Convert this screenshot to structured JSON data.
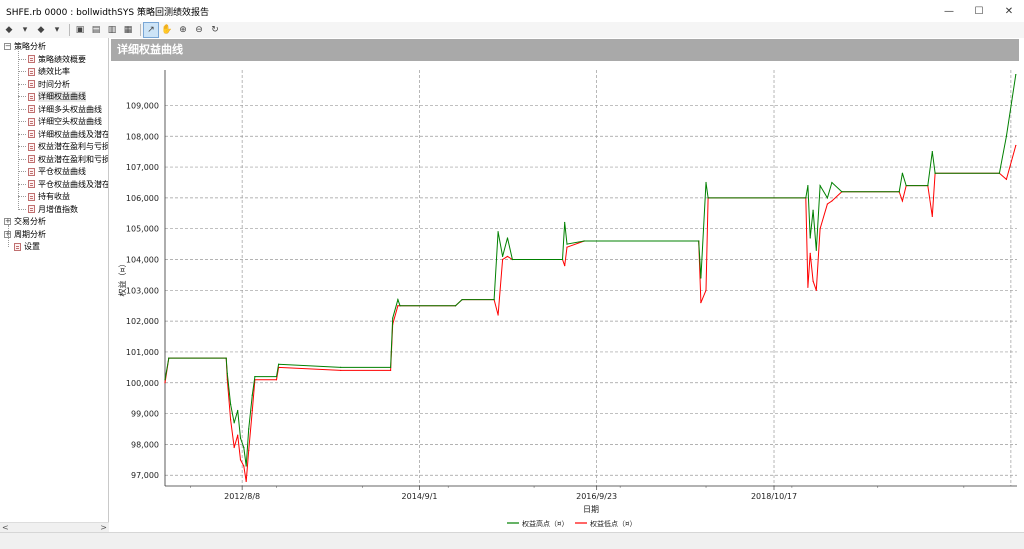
{
  "window": {
    "title": "SHFE.rb 0000 : bollwidthSYS 策略回测绩效报告",
    "minimize": "—",
    "maximize": "☐",
    "close": "✕"
  },
  "toolbar": {
    "buttons": [
      {
        "name": "back-icon",
        "glyph": "◆"
      },
      {
        "name": "back-dropdown-icon",
        "glyph": "▾"
      },
      {
        "name": "forward-icon",
        "glyph": "◆"
      },
      {
        "name": "forward-dropdown-icon",
        "glyph": "▾"
      },
      {
        "name": "save-icon",
        "glyph": "▣"
      },
      {
        "name": "export-icon",
        "glyph": "▤"
      },
      {
        "name": "print-preview-icon",
        "glyph": "▥"
      },
      {
        "name": "report-icon",
        "glyph": "▦"
      },
      {
        "name": "cursor-icon",
        "glyph": "↗"
      },
      {
        "name": "hand-icon",
        "glyph": "✋"
      },
      {
        "name": "zoom-in-icon",
        "glyph": "⊕"
      },
      {
        "name": "zoom-out-icon",
        "glyph": "⊖"
      },
      {
        "name": "refresh-icon",
        "glyph": "↻"
      }
    ]
  },
  "sidebar": {
    "groups": [
      {
        "label": "策略分析",
        "expander": "⊟",
        "items": [
          "策略绩效概要",
          "绩效比率",
          "时间分析",
          "详细权益曲线",
          "详细多头权益曲线",
          "详细空头权益曲线",
          "详细权益曲线及潜在",
          "权益潜在盈利与亏损",
          "权益潜在盈利和亏损",
          "平仓权益曲线",
          "平仓权益曲线及潜在",
          "持有收益",
          "月增值指数"
        ],
        "selected": 3
      },
      {
        "label": "交易分析",
        "expander": "⊞",
        "items": []
      },
      {
        "label": "周期分析",
        "expander": "⊞",
        "items": []
      }
    ],
    "settings": "设置",
    "scroll_left": "<",
    "scroll_right": ">"
  },
  "chart_header": "详细权益曲线",
  "chart_data": {
    "type": "line",
    "title": "详细权益曲线",
    "xlabel": "日期",
    "ylabel": "权益（¤）",
    "x_ticks": [
      "2012/8/8",
      "2014/9/1",
      "2016/9/23",
      "2018/10/17"
    ],
    "y_ticks": [
      97000,
      98000,
      99000,
      100000,
      101000,
      102000,
      103000,
      104000,
      105000,
      106000,
      107000,
      108000,
      109000
    ],
    "ylim": [
      96650,
      110150
    ],
    "xlim": [
      "2011-09-15",
      "2021-08-15"
    ],
    "grid": true,
    "legend_position": "bottom",
    "series": [
      {
        "name": "权益高点（¤）",
        "color": "#008000",
        "points": [
          [
            "2011-09-15",
            100100
          ],
          [
            "2011-10-01",
            100800
          ],
          [
            "2012-06-01",
            100800
          ],
          [
            "2012-06-06",
            100300
          ],
          [
            "2012-06-20",
            99300
          ],
          [
            "2012-07-05",
            98700
          ],
          [
            "2012-07-20",
            99100
          ],
          [
            "2012-08-01",
            98200
          ],
          [
            "2012-08-15",
            97900
          ],
          [
            "2012-08-25",
            97300
          ],
          [
            "2012-09-05",
            98500
          ],
          [
            "2012-09-20",
            99600
          ],
          [
            "2012-10-01",
            100200
          ],
          [
            "2013-01-01",
            100200
          ],
          [
            "2013-01-10",
            100600
          ],
          [
            "2013-10-01",
            100500
          ],
          [
            "2014-05-01",
            100500
          ],
          [
            "2014-05-10",
            102100
          ],
          [
            "2014-06-01",
            102700
          ],
          [
            "2014-06-10",
            102500
          ],
          [
            "2015-02-01",
            102500
          ],
          [
            "2015-03-01",
            102700
          ],
          [
            "2015-07-15",
            102700
          ],
          [
            "2015-08-01",
            104900
          ],
          [
            "2015-08-20",
            104100
          ],
          [
            "2015-09-10",
            104700
          ],
          [
            "2015-10-01",
            104000
          ],
          [
            "2016-05-01",
            104000
          ],
          [
            "2016-05-10",
            105200
          ],
          [
            "2016-05-20",
            104500
          ],
          [
            "2016-08-01",
            104600
          ],
          [
            "2017-12-01",
            104600
          ],
          [
            "2017-12-10",
            103400
          ],
          [
            "2018-01-01",
            106500
          ],
          [
            "2018-01-10",
            106000
          ],
          [
            "2019-03-01",
            106000
          ],
          [
            "2019-03-10",
            106400
          ],
          [
            "2019-03-20",
            104700
          ],
          [
            "2019-04-01",
            105600
          ],
          [
            "2019-04-15",
            104300
          ],
          [
            "2019-05-01",
            106400
          ],
          [
            "2019-06-01",
            106000
          ],
          [
            "2019-06-20",
            106500
          ],
          [
            "2019-08-01",
            106200
          ],
          [
            "2020-04-01",
            106200
          ],
          [
            "2020-04-15",
            106800
          ],
          [
            "2020-05-01",
            106400
          ],
          [
            "2020-08-01",
            106400
          ],
          [
            "2020-08-20",
            107500
          ],
          [
            "2020-09-01",
            106800
          ],
          [
            "2021-06-01",
            106800
          ],
          [
            "2021-07-01",
            108000
          ],
          [
            "2021-08-10",
            110000
          ]
        ]
      },
      {
        "name": "权益低点（¤）",
        "color": "#ff0000",
        "points": [
          [
            "2011-09-15",
            100000
          ],
          [
            "2011-10-01",
            100800
          ],
          [
            "2012-06-01",
            100800
          ],
          [
            "2012-06-06",
            100100
          ],
          [
            "2012-06-20",
            98800
          ],
          [
            "2012-07-05",
            97900
          ],
          [
            "2012-07-20",
            98300
          ],
          [
            "2012-08-01",
            97500
          ],
          [
            "2012-08-15",
            97300
          ],
          [
            "2012-08-25",
            96800
          ],
          [
            "2012-09-05",
            97800
          ],
          [
            "2012-09-20",
            99100
          ],
          [
            "2012-10-01",
            100100
          ],
          [
            "2013-01-01",
            100100
          ],
          [
            "2013-01-10",
            100500
          ],
          [
            "2013-10-01",
            100400
          ],
          [
            "2014-05-01",
            100400
          ],
          [
            "2014-05-10",
            101900
          ],
          [
            "2014-06-01",
            102500
          ],
          [
            "2014-06-10",
            102500
          ],
          [
            "2015-02-01",
            102500
          ],
          [
            "2015-03-01",
            102700
          ],
          [
            "2015-07-15",
            102700
          ],
          [
            "2015-08-01",
            102200
          ],
          [
            "2015-08-20",
            104000
          ],
          [
            "2015-09-10",
            104100
          ],
          [
            "2015-10-01",
            104000
          ],
          [
            "2016-05-01",
            104000
          ],
          [
            "2016-05-10",
            103800
          ],
          [
            "2016-05-20",
            104400
          ],
          [
            "2016-08-01",
            104600
          ],
          [
            "2017-12-01",
            104600
          ],
          [
            "2017-12-10",
            102600
          ],
          [
            "2018-01-01",
            103000
          ],
          [
            "2018-01-10",
            106000
          ],
          [
            "2019-03-01",
            106000
          ],
          [
            "2019-03-10",
            103100
          ],
          [
            "2019-03-20",
            104200
          ],
          [
            "2019-04-01",
            103300
          ],
          [
            "2019-04-15",
            103000
          ],
          [
            "2019-05-01",
            105000
          ],
          [
            "2019-06-01",
            105800
          ],
          [
            "2019-06-20",
            105900
          ],
          [
            "2019-08-01",
            106200
          ],
          [
            "2020-04-01",
            106200
          ],
          [
            "2020-04-15",
            105900
          ],
          [
            "2020-05-01",
            106400
          ],
          [
            "2020-08-01",
            106400
          ],
          [
            "2020-08-20",
            105400
          ],
          [
            "2020-09-01",
            106800
          ],
          [
            "2021-06-01",
            106800
          ],
          [
            "2021-07-01",
            106600
          ],
          [
            "2021-08-10",
            107700
          ]
        ]
      }
    ]
  }
}
